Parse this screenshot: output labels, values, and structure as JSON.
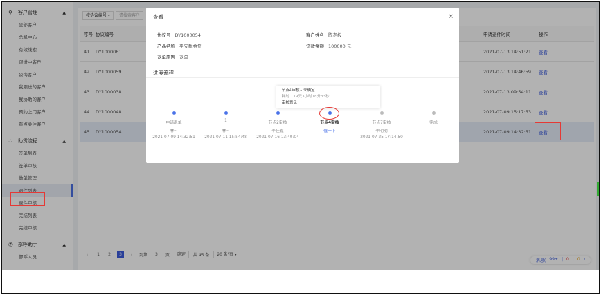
{
  "sidebar": {
    "groups": [
      {
        "label": "客户管理",
        "icon": "user-search-icon",
        "items": [
          "全部客户",
          "总机中心",
          "有效线索",
          "跟进中客户",
          "公海客户",
          "我跟进的客户",
          "我协助的客户",
          "预约上门客户",
          "重点关注客户"
        ]
      },
      {
        "label": "助贷流程",
        "icon": "flow-icon",
        "items": [
          "签单列表",
          "签单审核",
          "做单管理",
          "退件列表",
          "退件审核",
          "完结列表",
          "完结审核"
        ]
      },
      {
        "label": "部呼助手",
        "icon": "phone-icon",
        "items": [
          "部呼人员"
        ]
      }
    ],
    "active_item": "退件列表"
  },
  "filter": {
    "select": "按协议编号",
    "placeholder": "请搜索客户"
  },
  "table": {
    "headers": [
      "序号",
      "协议编号",
      "申请退件时间",
      "操作"
    ],
    "rows": [
      {
        "no": "41",
        "id": "DY1000061",
        "time": "2021-07-13 14:51:21",
        "action": "查看"
      },
      {
        "no": "42",
        "id": "DY1000059",
        "time": "2021-07-13 14:46:59",
        "action": "查看"
      },
      {
        "no": "43",
        "id": "DY1000038",
        "time": "2021-07-13 09:54:11",
        "action": "查看"
      },
      {
        "no": "44",
        "id": "DY1000048",
        "time": "2021-07-09 15:17:53",
        "action": "查看"
      },
      {
        "no": "45",
        "id": "DY1000054",
        "time": "2021-07-09 14:32:51",
        "action": "查看"
      }
    ]
  },
  "pager": {
    "prev": "‹",
    "pages": [
      "1",
      "2",
      "3"
    ],
    "current": "3",
    "next": "›",
    "goto_label": "到第",
    "goto_value": "3",
    "page_unit": "页",
    "confirm": "确定",
    "total": "共 45 条",
    "page_size": "20 条/页"
  },
  "messages": {
    "label": "消息(",
    "count": "99+",
    "sep1": "|",
    "a": "0",
    "sep2": "|",
    "b": "0",
    "close": ")"
  },
  "modal": {
    "title": "查看",
    "close": "×",
    "fields": {
      "agreement_label": "协议号",
      "agreement": "DY1000054",
      "customer_label": "客户姓名",
      "customer": "陈老板",
      "product_label": "产品名称",
      "product": "平安税金贷",
      "loan_label": "贷款金额",
      "loan": "100000 元",
      "reason_label": "退单原因",
      "reason": "退单"
    },
    "section": "进度流程",
    "tooltip": {
      "title": "节点4审核 - 未确定",
      "duration": "耗时：19天3小时18分33秒",
      "opinion": "审核意见："
    },
    "steps": [
      {
        "name": "申请退单",
        "user": "林~",
        "time": "2021-07-09 14:32:51",
        "status": "done"
      },
      {
        "name": "1",
        "user": "林~",
        "time": "2021-07-11 15:54:48",
        "status": "done"
      },
      {
        "name": "节点2审核",
        "user": "李佳鑫",
        "time": "2021-07-16 13:40:04",
        "status": "done"
      },
      {
        "name": "节点4审核",
        "user": "催一下",
        "time": "",
        "status": "current"
      },
      {
        "name": "节点7审核",
        "user": "李明明",
        "time": "2021-07-25 17:14:50",
        "status": "pending"
      },
      {
        "name": "完成",
        "user": "",
        "time": "",
        "status": "pending"
      }
    ]
  },
  "colors": {
    "accent": "#4a72e8",
    "highlight": "#e53935"
  }
}
